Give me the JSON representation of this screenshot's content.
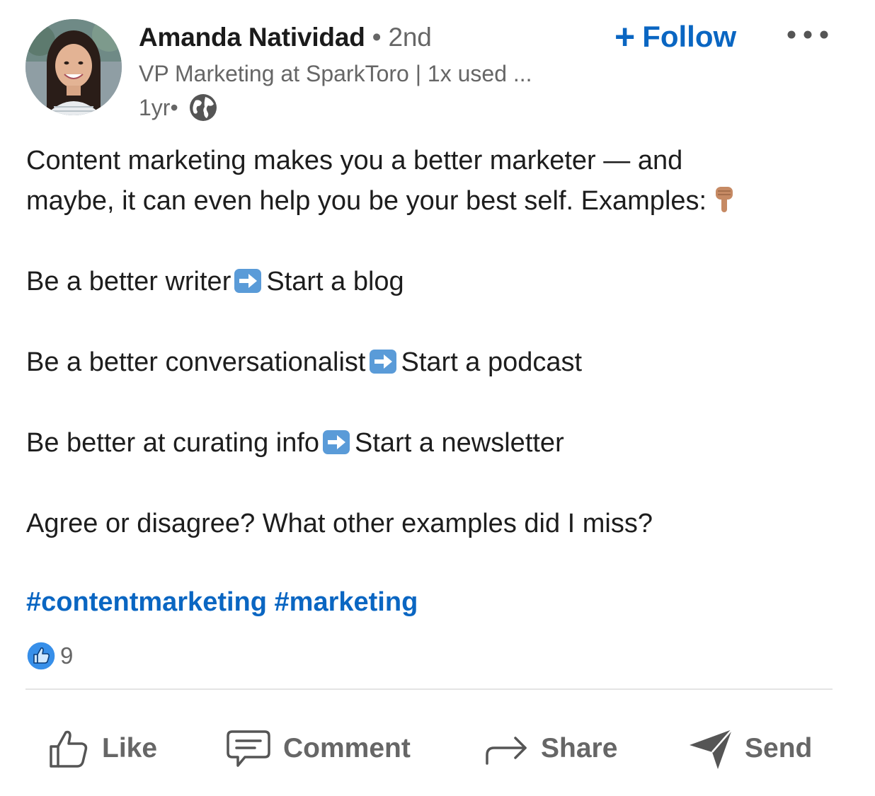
{
  "author": {
    "name": "Amanda Natividad",
    "degree": " • 2nd",
    "headline": "VP Marketing at SparkToro | 1x used ...",
    "time": "1yr",
    "separator": " •"
  },
  "follow": {
    "plus": "+",
    "label": "Follow"
  },
  "post": {
    "line1": "Content marketing makes you a better marketer — and",
    "line2": "maybe, it can even help you be your best self. Examples:",
    "ex1_a": "Be a better writer",
    "ex1_b": "Start a blog",
    "ex2_a": "Be a better conversationalist",
    "ex2_b": "Start a podcast",
    "ex3_a": "Be better at curating info",
    "ex3_b": "Start a newsletter",
    "question": "Agree or disagree? What other examples did I miss?",
    "hashtags": [
      "#contentmarketing",
      "#marketing"
    ]
  },
  "reactions": {
    "count": "9"
  },
  "actions": {
    "like": "Like",
    "comment": "Comment",
    "share": "Share",
    "send": "Send"
  },
  "colors": {
    "accent": "#0a66c2",
    "muted_text": "#666666",
    "body_text": "#1d1d1d",
    "divider": "#e4e4e4"
  }
}
